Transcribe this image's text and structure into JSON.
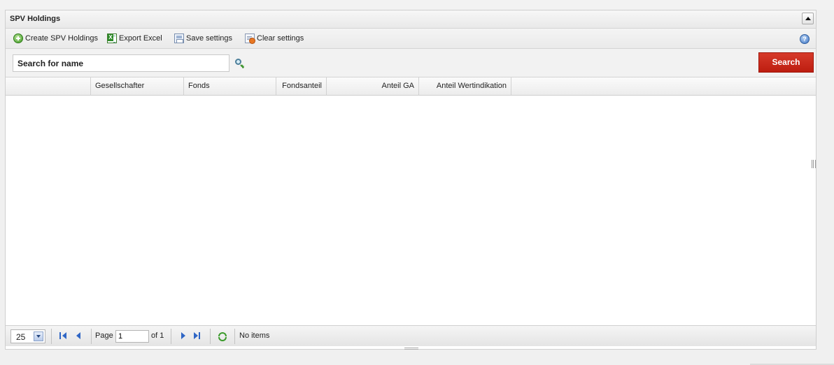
{
  "panel": {
    "title": "SPV Holdings"
  },
  "toolbar": {
    "create_label": "Create SPV Holdings",
    "export_label": "Export Excel",
    "save_label": "Save settings",
    "clear_label": "Clear settings",
    "help_glyph": "?"
  },
  "search": {
    "placeholder": "Search for name",
    "value": "",
    "button_label": "Search"
  },
  "grid": {
    "columns": [
      {
        "label": ""
      },
      {
        "label": "Gesellschafter"
      },
      {
        "label": "Fonds"
      },
      {
        "label": "Fondsanteil"
      },
      {
        "label": "Anteil GA"
      },
      {
        "label": "Anteil Wertindikation"
      }
    ],
    "rows": []
  },
  "pager": {
    "page_size": "25",
    "page_label": "Page",
    "current_page": "1",
    "of_label": "of 1",
    "status": "No items"
  },
  "colors": {
    "search_button": "#c8281a",
    "nav_icons": "#2f66c5",
    "refresh_icon": "#3a9a2a"
  },
  "icons": [
    "plus-circle-icon",
    "excel-icon",
    "save-settings-icon",
    "clear-settings-icon",
    "help-icon",
    "magnify-plus-icon",
    "first-page-icon",
    "prev-page-icon",
    "next-page-icon",
    "last-page-icon",
    "refresh-icon",
    "collapse-icon"
  ]
}
